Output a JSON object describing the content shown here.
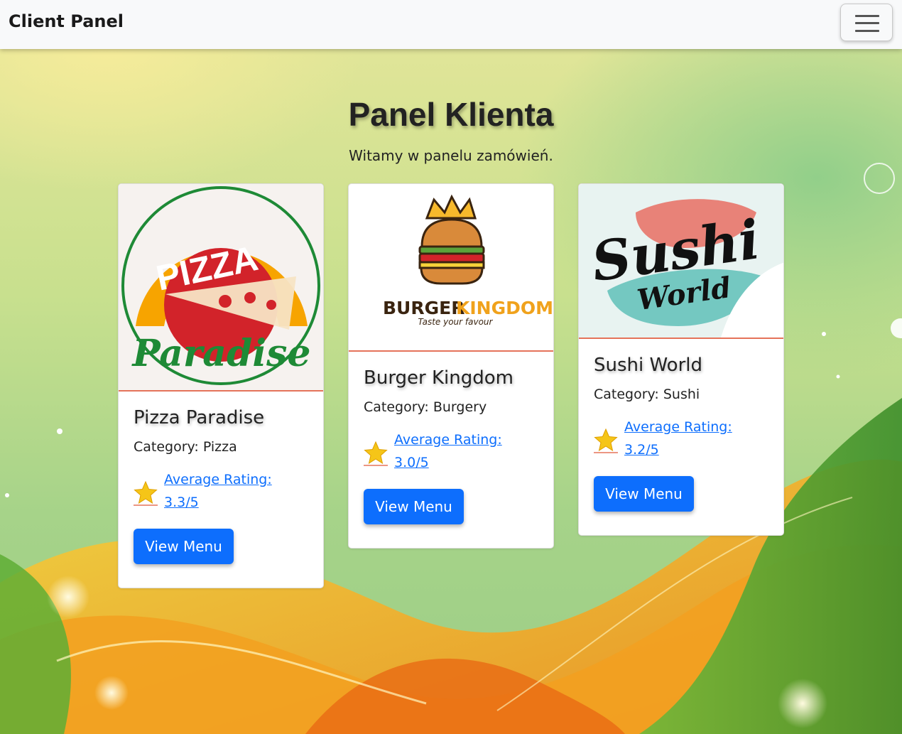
{
  "navbar": {
    "brand": "Client Panel",
    "menu_icon": "hamburger-menu-icon"
  },
  "hero": {
    "title": "Panel Klienta",
    "subtitle": "Witamy w panelu zamówień."
  },
  "restaurants": [
    {
      "name": "Pizza Paradise",
      "category": "Category: Pizza",
      "rating_line1": "Average Rating:",
      "rating_line2": "3.3/5",
      "button": "View Menu",
      "logo": {
        "main": "PIZZA",
        "script": "Paradise"
      }
    },
    {
      "name": "Burger Kingdom",
      "category": "Category: Burgery",
      "rating_line1": "Average Rating:",
      "rating_line2": "3.0/5",
      "button": "View Menu",
      "logo": {
        "word1": "BURGER",
        "word2": "KINGDOM",
        "tagline": "Taste your favour"
      }
    },
    {
      "name": "Sushi World",
      "category": "Category: Sushi",
      "rating_line1": "Average Rating:",
      "rating_line2": "3.2/5",
      "button": "View Menu",
      "logo": {
        "main": "Sushi",
        "script": "World"
      }
    }
  ],
  "colors": {
    "primary": "#0d6efd",
    "accent_border": "#e5735a",
    "star": "#f5c518"
  }
}
